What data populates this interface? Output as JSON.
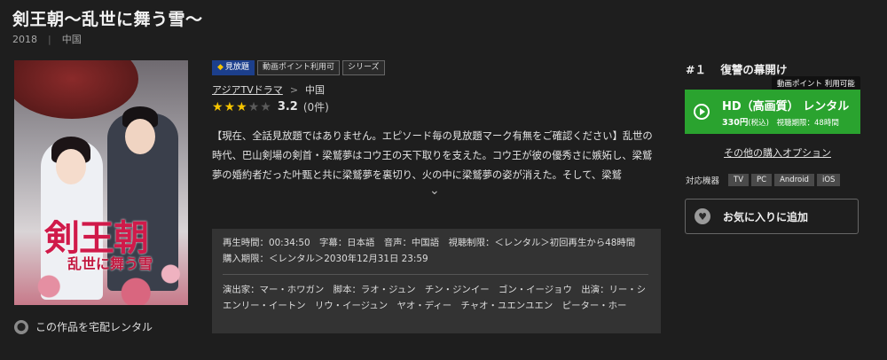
{
  "header": {
    "title": "剣王朝～乱世に舞う雪～",
    "year": "2018",
    "country": "中国"
  },
  "poster": {
    "logo_main": "剣王朝",
    "logo_sub": "乱世に舞う雪"
  },
  "delivery": {
    "label": "この作品を宅配レンタル",
    "icon": "delivery-icon"
  },
  "badges": {
    "free": "見放題",
    "points": "動画ポイント利用可",
    "series": "シリーズ"
  },
  "breadcrumb": {
    "category": "アジアTVドラマ",
    "separator": ">",
    "sub": "中国"
  },
  "rating": {
    "stars": 3,
    "max_stars": 5,
    "score": "3.2",
    "count": "(0件)"
  },
  "synopsis": {
    "text": "【現在、全話見放題ではありません。エピソード毎の見放題マーク有無をご確認ください】乱世の時代、巴山剣場の剣首・梁鷲夢はコウ王の天下取りを支えた。コウ王が彼の優秀さに嫉妬し、梁鷲夢の婚約者だった叶甄と共に梁鷲夢を裏切り、火の中に梁鷲夢の姿が消えた。そして、梁鷲",
    "expand_icon": "⌄"
  },
  "info": {
    "line1": "再生時間：00:34:50　字幕：日本語　音声：中国語　視聴制限：＜レンタル＞初回再生から48時間　購入期限：＜レンタル＞2030年12月31日 23:59",
    "line2": "演出家：マー・ホワガン　脚本：ラオ・ジュン　チン・ジンイー　ゴン・イージョウ　出演：リー・シエンリー・イートン　リウ・イージュン　ヤオ・ディー　チャオ・ユエンユエン　ピーター・ホー"
  },
  "episode": {
    "number": "#１",
    "title": "復讐の幕開け"
  },
  "tooltip": "動画ポイント 利用可能",
  "rent_button": {
    "label": "HD（高画質）  レンタル",
    "price": "330円",
    "tax": "(税込)",
    "period": "視聴期限：48時間",
    "color": "#2aa32f"
  },
  "other_options": "その他の購入オプション",
  "devices": {
    "label": "対応機器",
    "list": [
      "TV",
      "PC",
      "Android",
      "iOS"
    ]
  },
  "favorite": {
    "label": "お気に入りに追加",
    "icon": "heart-icon"
  }
}
